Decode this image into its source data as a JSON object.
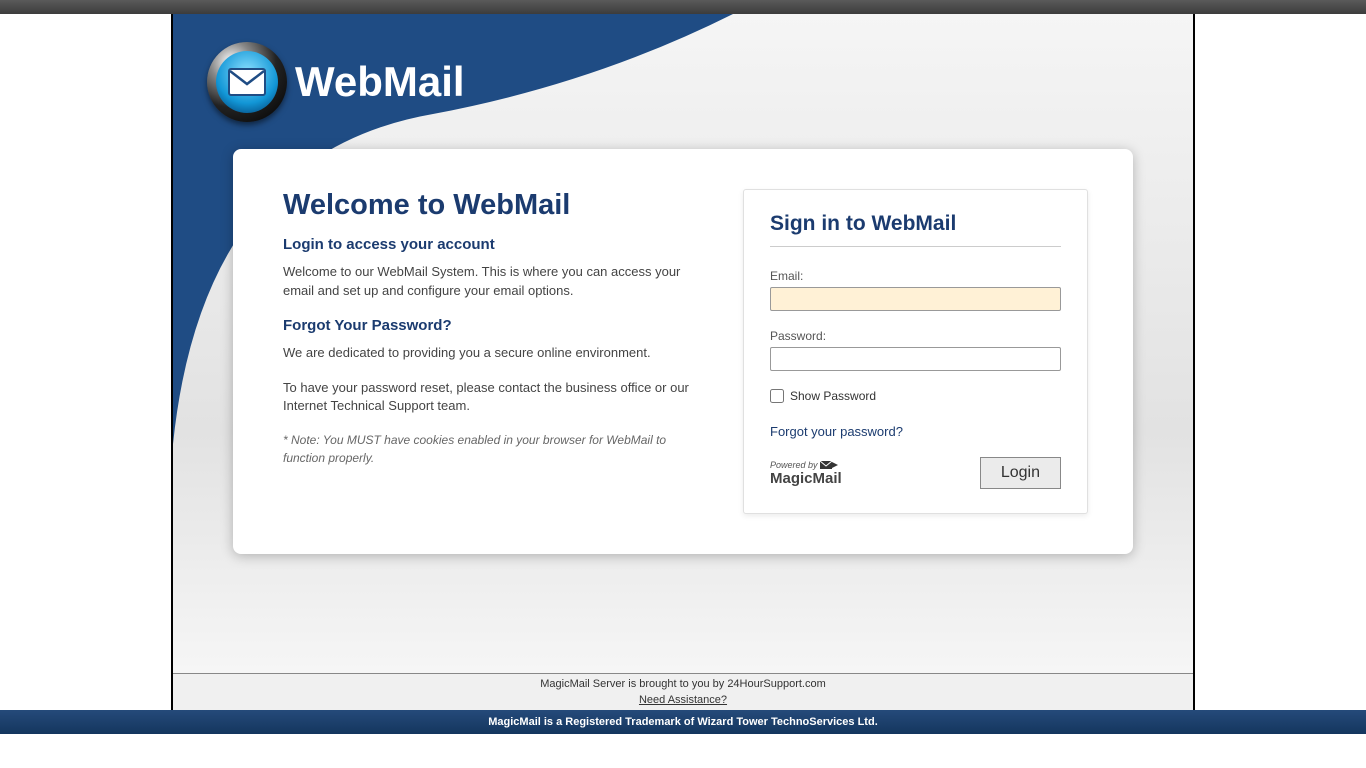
{
  "brand": {
    "name": "WebMail"
  },
  "welcome": {
    "title": "Welcome to WebMail",
    "subtitle": "Login to access your account",
    "intro": "Welcome to our WebMail System. This is where you can access your email and set up and configure your email options.",
    "forgot_heading": "Forgot Your Password?",
    "forgot_p1": "We are dedicated to providing you a secure online environment.",
    "forgot_p2": "To have your password reset, please contact the business office or our Internet Technical Support team.",
    "note": "* Note: You MUST have cookies enabled in your browser for WebMail to function properly."
  },
  "login": {
    "title": "Sign in to WebMail",
    "email_label": "Email:",
    "email_value": "",
    "password_label": "Password:",
    "password_value": "",
    "show_password_label": "Show Password",
    "forgot_link": "Forgot your password?",
    "powered_prefix": "Powered by",
    "powered_brand": "MagicMail",
    "button_label": "Login"
  },
  "footer": {
    "brought": "MagicMail Server is brought to you by 24HourSupport.com",
    "assist": "Need Assistance?",
    "trademark": "MagicMail is a Registered Trademark of Wizard Tower TechnoServices Ltd."
  }
}
